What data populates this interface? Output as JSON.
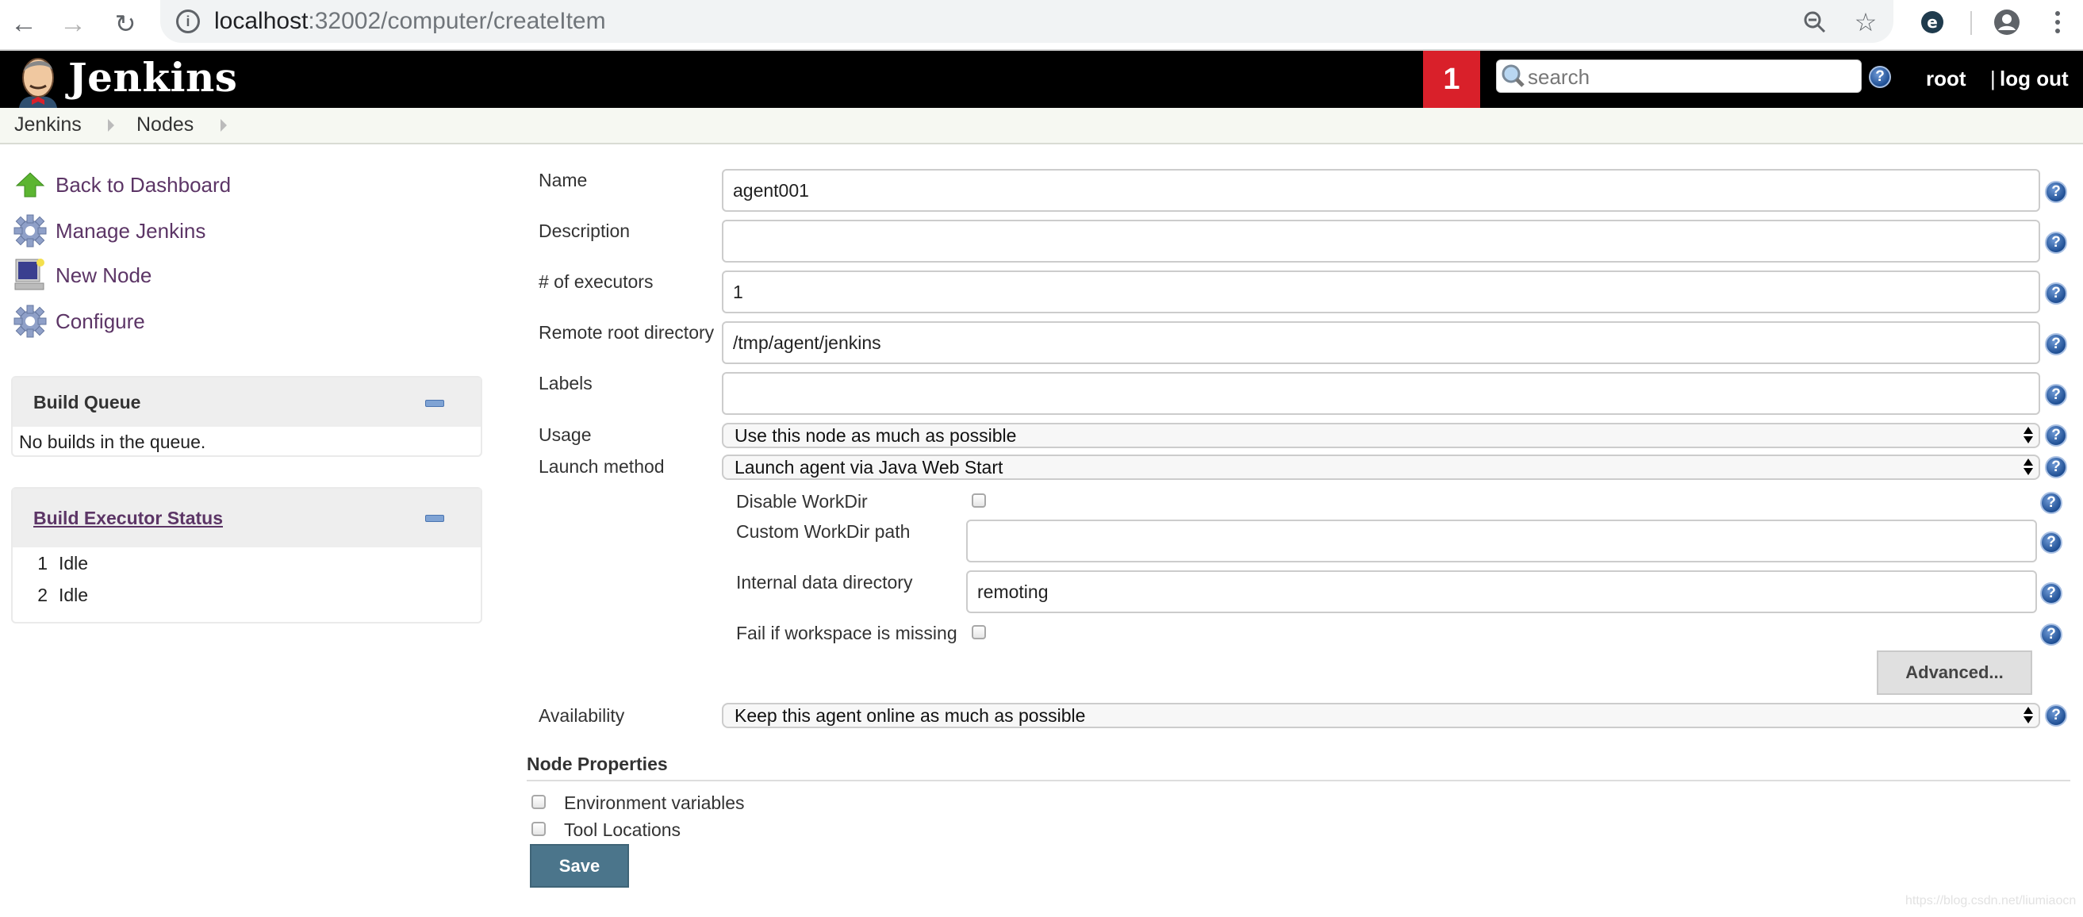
{
  "browser": {
    "url_host": "localhost",
    "url_rest": ":32002/computer/createItem"
  },
  "header": {
    "app_name": "Jenkins",
    "notification_count": "1",
    "search_placeholder": "search",
    "user": "root",
    "separator": "|",
    "logout_label": "log out"
  },
  "breadcrumb": [
    "Jenkins",
    "Nodes"
  ],
  "sidebar": {
    "links": [
      {
        "label": "Back to Dashboard",
        "icon": "up-arrow-icon"
      },
      {
        "label": "Manage Jenkins",
        "icon": "gear-icon"
      },
      {
        "label": "New Node",
        "icon": "computer-icon"
      },
      {
        "label": "Configure",
        "icon": "gear-icon"
      }
    ],
    "build_queue": {
      "title": "Build Queue",
      "empty_text": "No builds in the queue."
    },
    "executor_status": {
      "title": "Build Executor Status",
      "executors": [
        {
          "number": "1",
          "status": "Idle"
        },
        {
          "number": "2",
          "status": "Idle"
        }
      ]
    }
  },
  "form": {
    "name": {
      "label": "Name",
      "value": "agent001"
    },
    "description": {
      "label": "Description",
      "value": ""
    },
    "executors": {
      "label": "# of executors",
      "value": "1"
    },
    "remote_root": {
      "label": "Remote root directory",
      "value": "/tmp/agent/jenkins"
    },
    "labels": {
      "label": "Labels",
      "value": ""
    },
    "usage": {
      "label": "Usage",
      "selected": "Use this node as much as possible"
    },
    "launch_method": {
      "label": "Launch method",
      "selected": "Launch agent via Java Web Start"
    },
    "disable_workdir": {
      "label": "Disable WorkDir",
      "checked": false
    },
    "custom_workdir": {
      "label": "Custom WorkDir path",
      "value": ""
    },
    "internal_data_dir": {
      "label": "Internal data directory",
      "value": "remoting"
    },
    "fail_if_missing": {
      "label": "Fail if workspace is missing",
      "checked": false
    },
    "advanced_label": "Advanced...",
    "availability": {
      "label": "Availability",
      "selected": "Keep this agent online as much as possible"
    },
    "node_properties": {
      "title": "Node Properties",
      "items": [
        {
          "label": "Environment variables",
          "checked": false
        },
        {
          "label": "Tool Locations",
          "checked": false
        }
      ]
    },
    "save_label": "Save"
  },
  "watermark": "https://blog.csdn.net/liumiaocn"
}
